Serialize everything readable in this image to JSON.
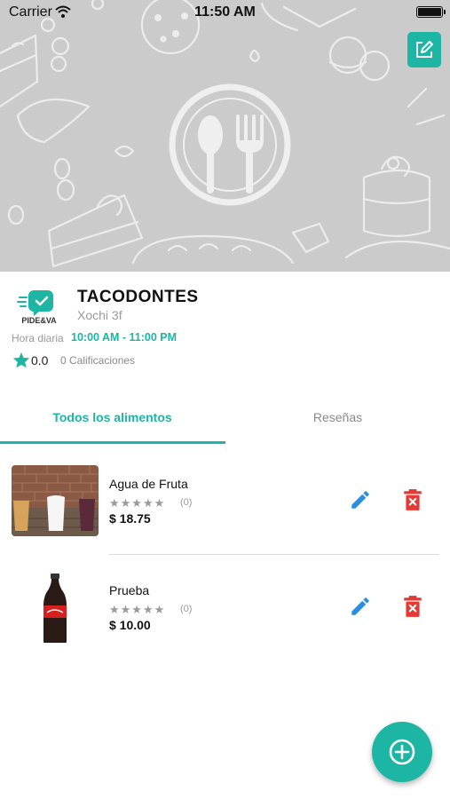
{
  "status_bar": {
    "carrier": "Carrier",
    "time": "11:50 AM"
  },
  "store": {
    "name": "TACODONTES",
    "address": "Xochi 3f",
    "hours_label": "Hora diaria",
    "hours_value": "10:00 AM - 11:00 PM",
    "rating": "0.0",
    "rating_count": "0 Calificaciones",
    "logo_text": "PIDE&VA"
  },
  "tabs": [
    {
      "label": "Todos los alimentos",
      "active": true
    },
    {
      "label": "Reseñas",
      "active": false
    }
  ],
  "items": [
    {
      "name": "Agua de Fruta",
      "stars": "★★★★★",
      "rating_count": "(0)",
      "price": "$ 18.75",
      "rating": 0
    },
    {
      "name": "Prueba",
      "stars": "★★★★★",
      "rating_count": "(0)",
      "price": "$ 10.00",
      "rating": 0
    }
  ],
  "colors": {
    "accent": "#1db5a3",
    "edit": "#2a8ee0",
    "delete": "#e53935",
    "banner": "#cbcbcb"
  },
  "icons": {
    "edit_store": "edit-square-icon",
    "item_edit": "pencil-icon",
    "item_delete": "trash-icon",
    "fab": "plus-circle-icon",
    "banner": "utensils-icon"
  }
}
